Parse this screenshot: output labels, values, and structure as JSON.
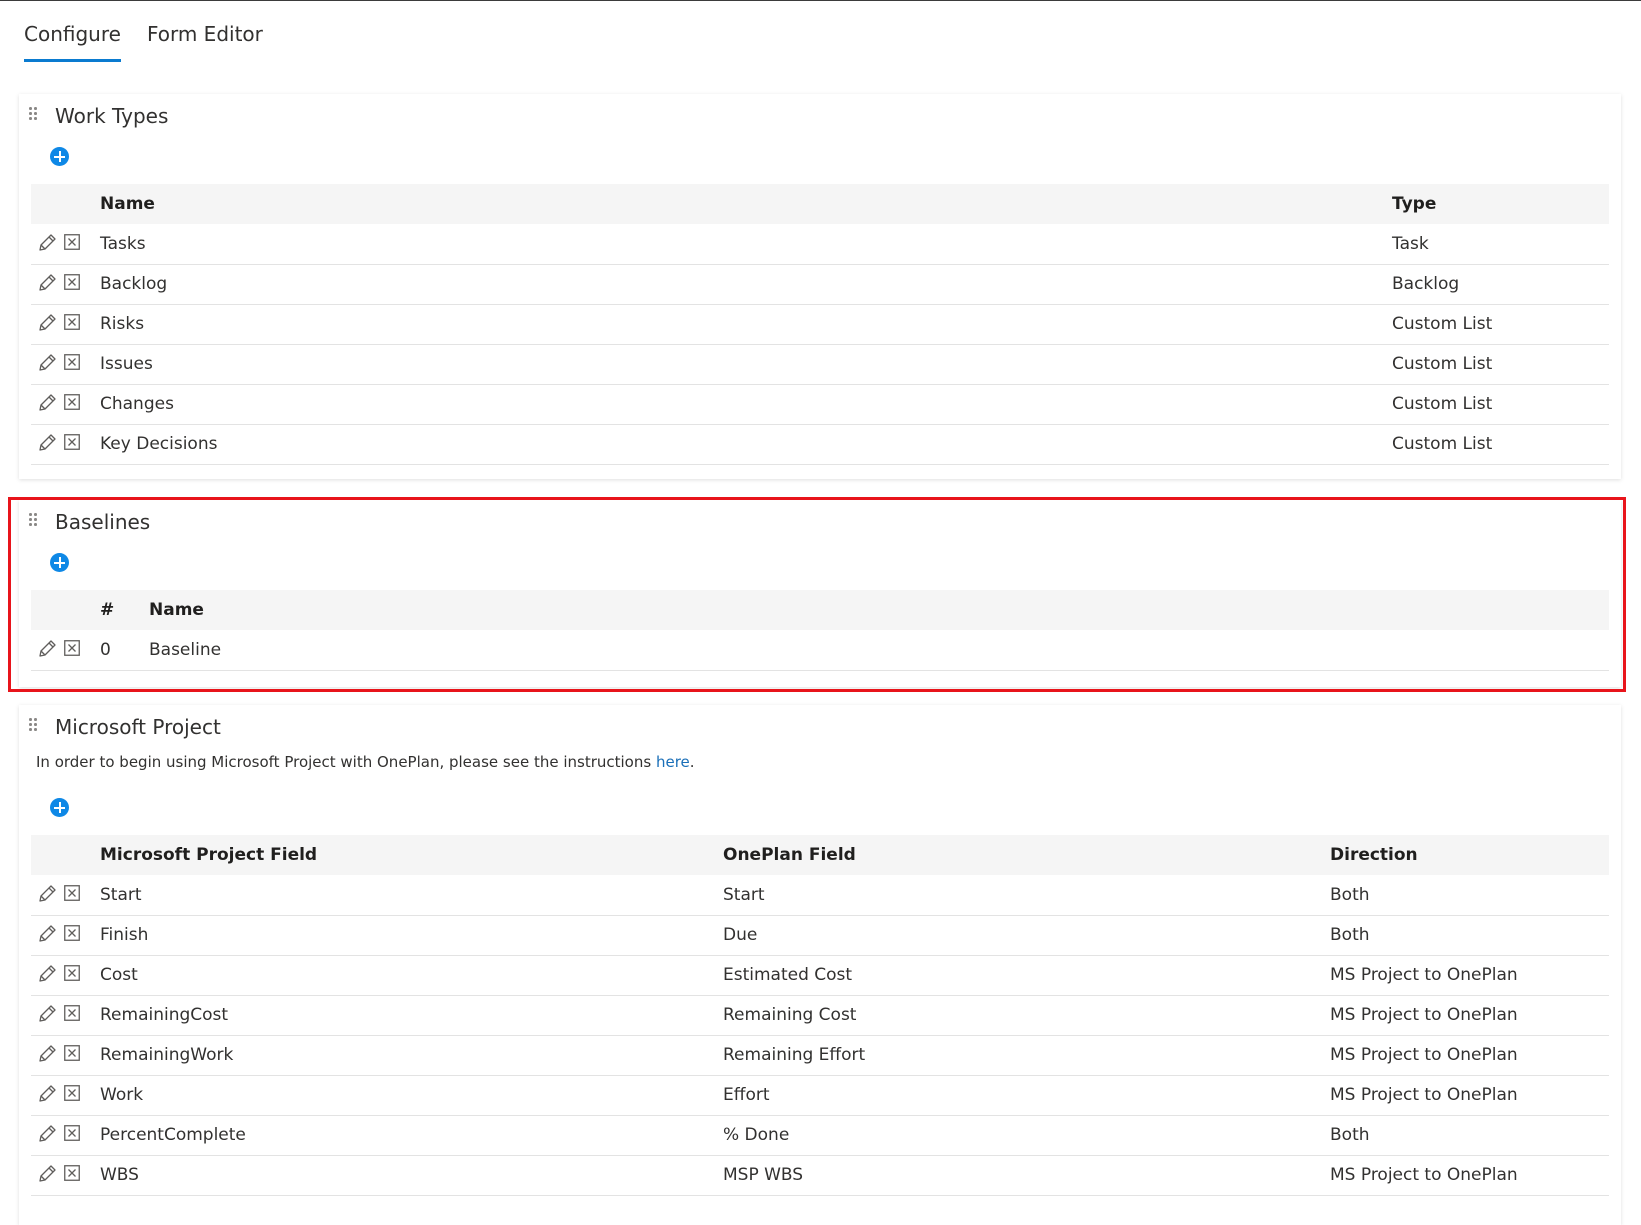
{
  "tabs": [
    {
      "label": "Configure",
      "active": true
    },
    {
      "label": "Form Editor",
      "active": false
    }
  ],
  "work_types": {
    "title": "Work Types",
    "columns": {
      "name": "Name",
      "type": "Type"
    },
    "rows": [
      {
        "name": "Tasks",
        "type": "Task"
      },
      {
        "name": "Backlog",
        "type": "Backlog"
      },
      {
        "name": "Risks",
        "type": "Custom List"
      },
      {
        "name": "Issues",
        "type": "Custom List"
      },
      {
        "name": "Changes",
        "type": "Custom List"
      },
      {
        "name": "Key Decisions",
        "type": "Custom List"
      }
    ]
  },
  "baselines": {
    "title": "Baselines",
    "columns": {
      "number": "#",
      "name": "Name"
    },
    "rows": [
      {
        "number": "0",
        "name": "Baseline"
      }
    ]
  },
  "ms_project": {
    "title": "Microsoft Project",
    "description": "In order to begin using Microsoft Project with OnePlan, please see the instructions ",
    "link_text": "here",
    "description_end": ".",
    "columns": {
      "ms_field": "Microsoft Project Field",
      "oneplan_field": "OnePlan Field",
      "direction": "Direction"
    },
    "rows": [
      {
        "ms_field": "Start",
        "oneplan_field": "Start",
        "direction": "Both"
      },
      {
        "ms_field": "Finish",
        "oneplan_field": "Due",
        "direction": "Both"
      },
      {
        "ms_field": "Cost",
        "oneplan_field": "Estimated Cost",
        "direction": "MS Project to OnePlan"
      },
      {
        "ms_field": "RemainingCost",
        "oneplan_field": "Remaining Cost",
        "direction": "MS Project to OnePlan"
      },
      {
        "ms_field": "RemainingWork",
        "oneplan_field": "Remaining Effort",
        "direction": "MS Project to OnePlan"
      },
      {
        "ms_field": "Work",
        "oneplan_field": "Effort",
        "direction": "MS Project to OnePlan"
      },
      {
        "ms_field": "PercentComplete",
        "oneplan_field": "% Done",
        "direction": "Both"
      },
      {
        "ms_field": "WBS",
        "oneplan_field": "MSP WBS",
        "direction": "MS Project to OnePlan"
      }
    ]
  },
  "icons": {
    "drag": "drag-handle-icon",
    "add": "add-circle-icon",
    "edit": "pencil-icon",
    "delete": "close-box-icon"
  },
  "colors": {
    "accent": "#0a7bd0",
    "add_button": "#0e88e6",
    "highlight": "#e8141b",
    "link": "#1a6fb8"
  }
}
